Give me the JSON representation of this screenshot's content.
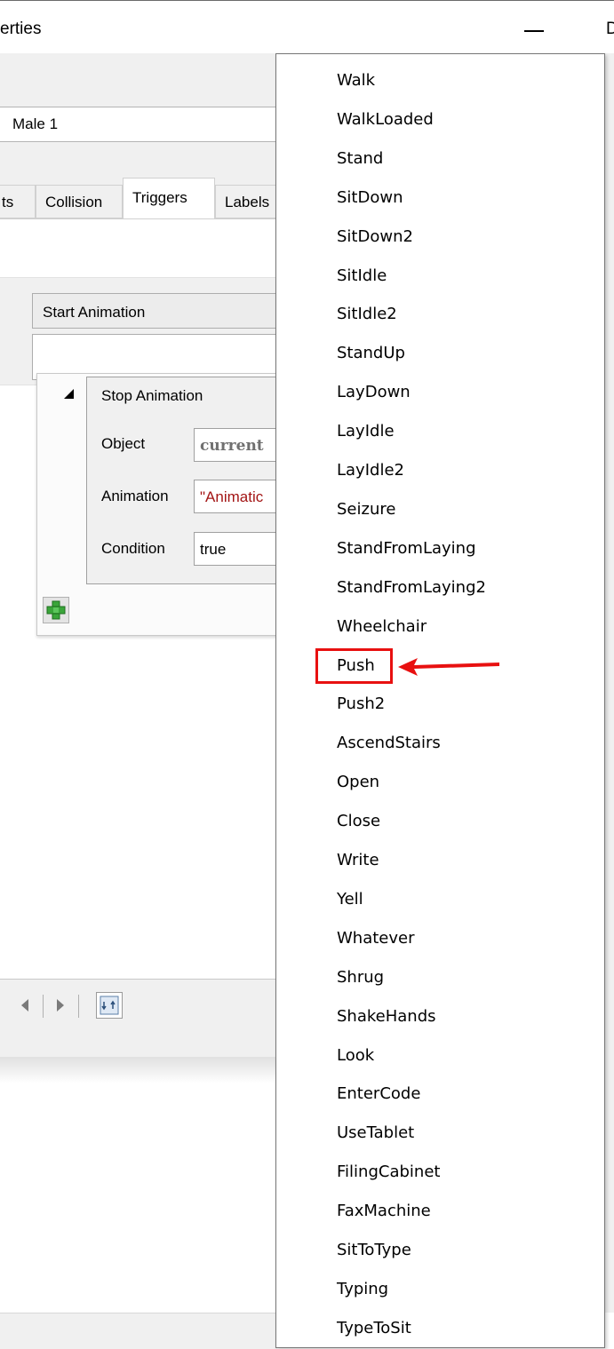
{
  "window": {
    "title_fragment": "erties",
    "right_edge_fragment": "D"
  },
  "properties": {
    "name_value": "Male 1",
    "tabs": [
      "ts",
      "Collision",
      "Triggers",
      "Labels"
    ],
    "active_tab": "Triggers",
    "trigger_select": "Start Animation",
    "action": {
      "title": "Stop Animation",
      "rows": [
        {
          "label": "Object",
          "value": "current"
        },
        {
          "label": "Animation",
          "value": "\"Animatic"
        },
        {
          "label": "Condition",
          "value": "true"
        }
      ]
    }
  },
  "dropdown": {
    "options": [
      "Walk",
      "WalkLoaded",
      "Stand",
      "SitDown",
      "SitDown2",
      "SitIdle",
      "SitIdle2",
      "StandUp",
      "LayDown",
      "LayIdle",
      "LayIdle2",
      "Seizure",
      "StandFromLaying",
      "StandFromLaying2",
      "Wheelchair",
      "Push",
      "Push2",
      "AscendStairs",
      "Open",
      "Close",
      "Write",
      "Yell",
      "Whatever",
      "Shrug",
      "ShakeHands",
      "Look",
      "EnterCode",
      "UseTablet",
      "FilingCabinet",
      "FaxMachine",
      "SitToType",
      "Typing",
      "TypeToSit"
    ],
    "highlighted_option": "Push"
  },
  "colors": {
    "highlight": "#e81010",
    "plus_icon": "#3aa53a",
    "string_literal": "#a31515",
    "keyword_grey": "#707070"
  },
  "icons": {
    "minimize": "minimize-icon",
    "collapse": "collapse-triangle-icon",
    "add": "plus-icon",
    "refresh": "refresh-icon",
    "arrow": "red-arrow-annotation"
  }
}
